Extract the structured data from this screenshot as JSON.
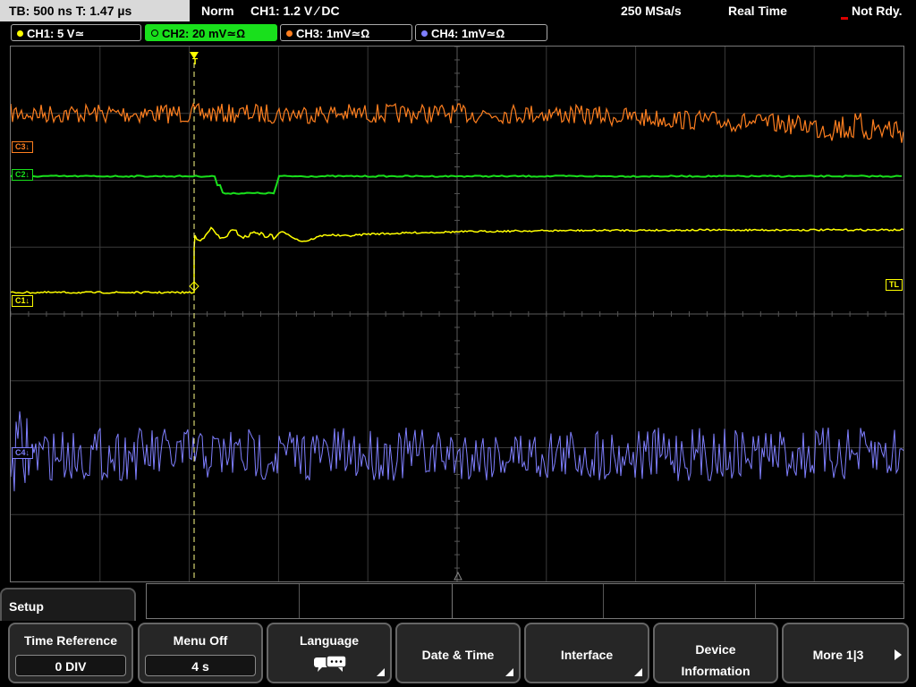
{
  "topbar": {
    "timebase": "TB: 500 ns   T: 1.47 µs",
    "mode": "Norm",
    "trigger": "CH1: 1.2 V ∕ DC",
    "sample_rate": "250 MSa/s",
    "acq_mode": "Real Time",
    "status": "Not Rdy."
  },
  "channels": [
    {
      "label": "CH1: 5 V≃",
      "color": "#ffff00",
      "active": false
    },
    {
      "label": "CH2: 20 mV≃Ω",
      "color": "#19e01c",
      "active": true
    },
    {
      "label": "CH3: 1mV≃Ω",
      "color": "#ff7f1f",
      "active": false
    },
    {
      "label": "CH4: 1mV≃Ω",
      "color": "#7f7fff",
      "active": false
    }
  ],
  "markers": {
    "c3": "C3↓",
    "c2": "C2↓",
    "c1": "C1↓",
    "c4": "C4↓",
    "trigger_level": "TL",
    "trigger_pos": "T"
  },
  "menu": {
    "title": "Setup",
    "softkeys": [
      {
        "label": "Time Reference",
        "value": "0 DIV"
      },
      {
        "label": "Menu Off",
        "value": "4 s"
      },
      {
        "label": "Language",
        "icon": "speech-bubbles-icon"
      },
      {
        "label": "Date & Time"
      },
      {
        "label": "Interface"
      },
      {
        "label": "Device Information"
      },
      {
        "label": "More 1|3"
      }
    ]
  }
}
